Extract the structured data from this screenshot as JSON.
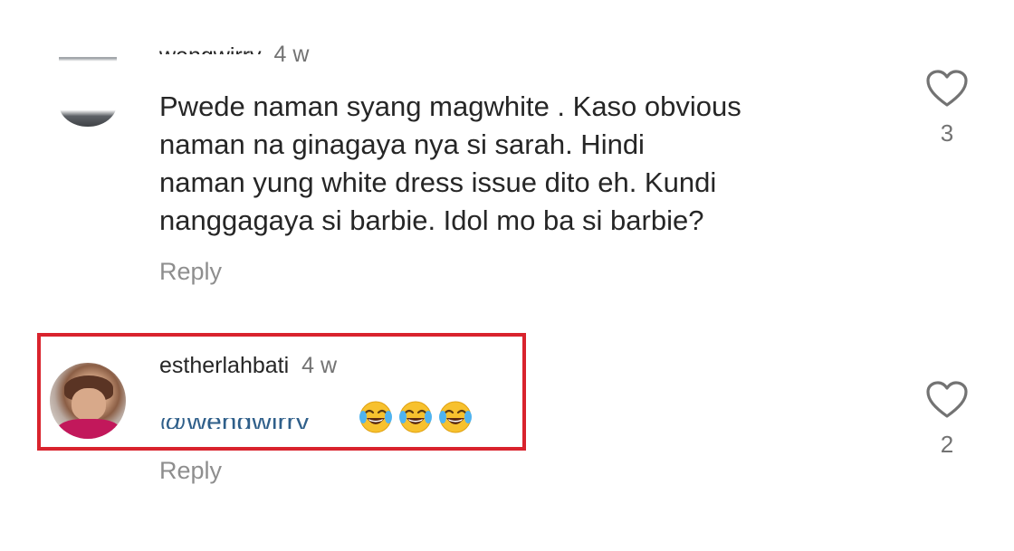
{
  "comments": [
    {
      "username": "wengwirry",
      "time": "4 w",
      "text_lines": [
        "Pwede naman syang magwhite . Kaso obvious",
        "naman na  ginagaya nya si sarah. Hindi",
        "naman yung white dress issue dito eh. Kundi",
        "nanggagaya si barbie. Idol mo ba si barbie?"
      ],
      "reply_label": "Reply",
      "likes": "3"
    },
    {
      "username": "estherlahbati",
      "time": "4 w",
      "mention": "@wengwirry",
      "emojis": [
        "face-with-tears-of-joy",
        "face-with-tears-of-joy",
        "face-with-tears-of-joy"
      ],
      "reply_label": "Reply",
      "likes": "2"
    }
  ],
  "colors": {
    "highlight": "#d9232d",
    "text": "#262626",
    "muted": "#737373",
    "mention": "#2f5f8a"
  }
}
